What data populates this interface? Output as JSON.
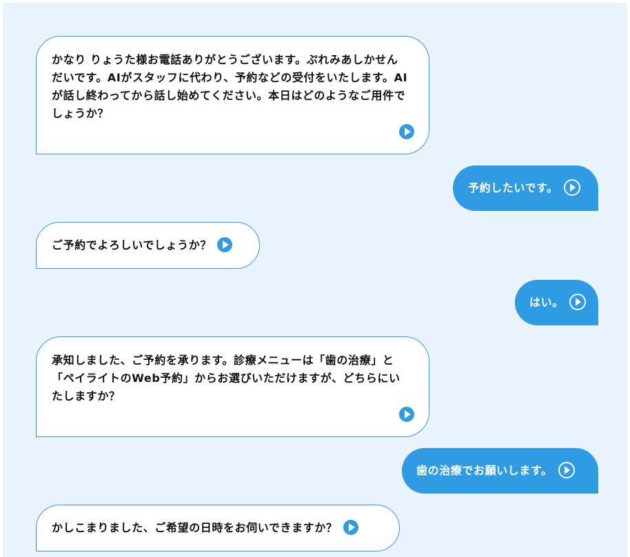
{
  "messages": [
    {
      "role": "bot",
      "text": "かなり りょうた様お電話ありがとうございます。ぷれみあしかせんだいです。AIがスタッフに代わり、予約などの受付をいたします。AIが話し終わってから話し始めてください。本日はどのようなご用件でしょうか？",
      "icon": "play-icon"
    },
    {
      "role": "user",
      "text": "予約したいです。",
      "icon": "play-icon"
    },
    {
      "role": "bot",
      "text": "ご予約でよろしいでしょうか？",
      "icon": "play-icon"
    },
    {
      "role": "user",
      "text": "はい。",
      "icon": "play-icon"
    },
    {
      "role": "bot",
      "text": "承知しました、ご予約を承ります。診療メニューは「歯の治療」と「ペイライトのWeb予約」からお選びいただけますが、どちらにいたしますか？",
      "icon": "play-icon"
    },
    {
      "role": "user",
      "text": "歯の治療でお願いします。",
      "icon": "play-icon"
    },
    {
      "role": "bot",
      "text": "かしこまりました、ご希望の日時をお伺いできますか？",
      "icon": "play-icon"
    }
  ],
  "colors": {
    "background": "#e8f3fc",
    "accent": "#2f9be3",
    "bot_bubble": "#ffffff",
    "text": "#111111"
  }
}
